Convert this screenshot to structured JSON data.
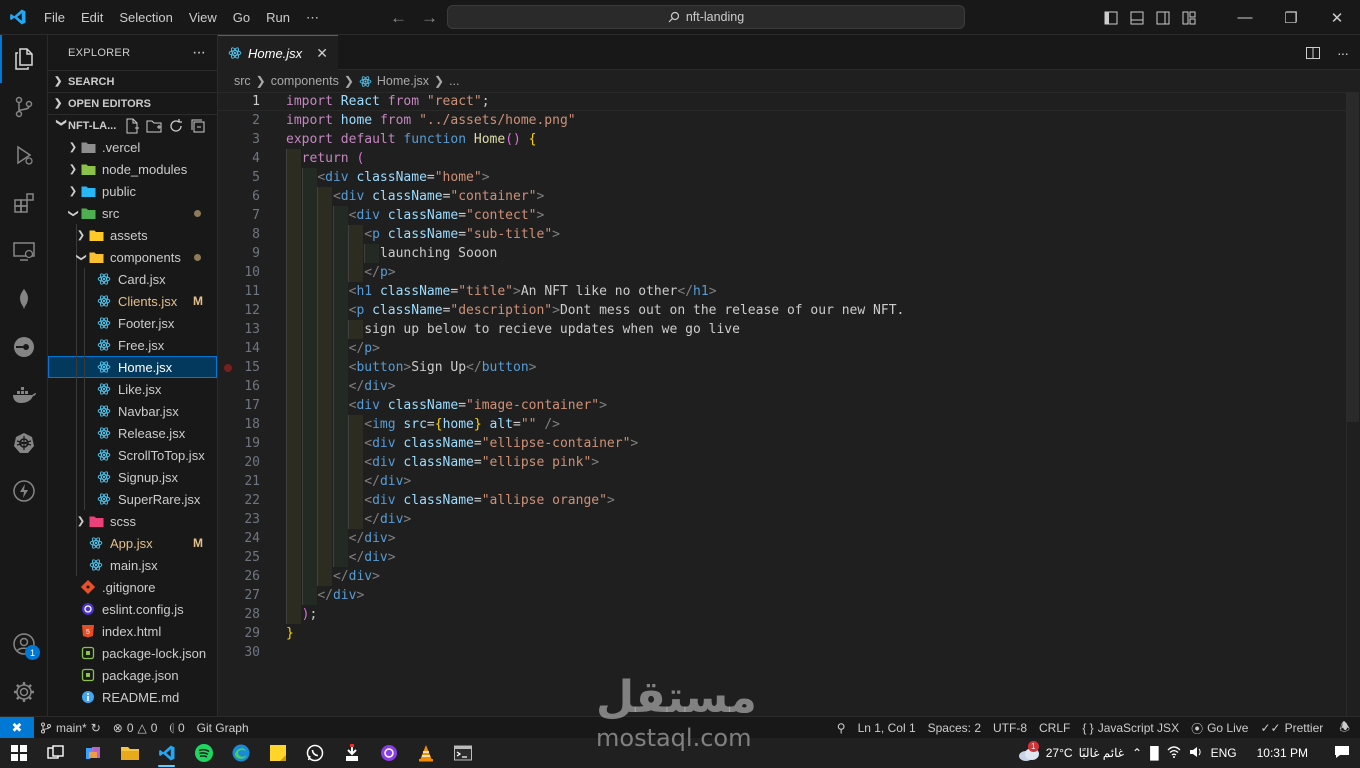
{
  "titlebar": {
    "menu": [
      "File",
      "Edit",
      "Selection",
      "View",
      "Go",
      "Run",
      "⋯"
    ],
    "command_center": "nft-landing"
  },
  "activity_bar": {
    "items": [
      "explorer-icon",
      "source-control-icon",
      "run-debug-icon",
      "extensions-icon",
      "remote-explorer-icon",
      "mongodb-icon",
      "gitlens-icon",
      "docker-icon",
      "kubernetes-icon",
      "thunder-client-icon"
    ],
    "accounts_badge": "1"
  },
  "explorer": {
    "title": "EXPLORER",
    "more": "···",
    "sections": {
      "search": "SEARCH",
      "open_editors": "OPEN EDITORS",
      "project": "NFT-LA..."
    },
    "tree": [
      {
        "label": ".vercel",
        "type": "folder",
        "depth": 1,
        "open": false
      },
      {
        "label": "node_modules",
        "type": "folder",
        "depth": 1,
        "open": false
      },
      {
        "label": "public",
        "type": "folder",
        "depth": 1,
        "open": false
      },
      {
        "label": "src",
        "type": "folder",
        "depth": 1,
        "open": true,
        "status": "dot"
      },
      {
        "label": "assets",
        "type": "folder",
        "depth": 2,
        "open": false
      },
      {
        "label": "components",
        "type": "folder",
        "depth": 2,
        "open": true,
        "status": "dot"
      },
      {
        "label": "Card.jsx",
        "type": "react",
        "depth": 3
      },
      {
        "label": "Clients.jsx",
        "type": "react",
        "depth": 3,
        "status": "M"
      },
      {
        "label": "Footer.jsx",
        "type": "react",
        "depth": 3
      },
      {
        "label": "Free.jsx",
        "type": "react",
        "depth": 3
      },
      {
        "label": "Home.jsx",
        "type": "react",
        "depth": 3,
        "selected": true
      },
      {
        "label": "Like.jsx",
        "type": "react",
        "depth": 3
      },
      {
        "label": "Navbar.jsx",
        "type": "react",
        "depth": 3
      },
      {
        "label": "Release.jsx",
        "type": "react",
        "depth": 3
      },
      {
        "label": "ScrollToTop.jsx",
        "type": "react",
        "depth": 3
      },
      {
        "label": "Signup.jsx",
        "type": "react",
        "depth": 3
      },
      {
        "label": "SuperRare.jsx",
        "type": "react",
        "depth": 3
      },
      {
        "label": "scss",
        "type": "folder",
        "depth": 2,
        "open": false
      },
      {
        "label": "App.jsx",
        "type": "react",
        "depth": 2,
        "status": "M"
      },
      {
        "label": "main.jsx",
        "type": "react",
        "depth": 2
      },
      {
        "label": ".gitignore",
        "type": "git",
        "depth": 1
      },
      {
        "label": "eslint.config.js",
        "type": "js",
        "depth": 1
      },
      {
        "label": "index.html",
        "type": "html",
        "depth": 1
      },
      {
        "label": "package-lock.json",
        "type": "json",
        "depth": 1
      },
      {
        "label": "package.json",
        "type": "json",
        "depth": 1
      },
      {
        "label": "README.md",
        "type": "info",
        "depth": 1
      }
    ]
  },
  "tabs": [
    {
      "label": "Home.jsx",
      "active": true
    }
  ],
  "breadcrumbs": [
    "src",
    "components",
    "Home.jsx",
    "..."
  ],
  "editor": {
    "current_line": 1,
    "breakpoint_line": 15,
    "lines": [
      "import React from \"react\";",
      "import home from \"../assets/home.png\"",
      "export default function Home() {",
      "  return (",
      "    <div className=\"home\">",
      "      <div className=\"container\">",
      "        <div className=\"contect\">",
      "          <p className=\"sub-title\">",
      "            launching Sooon",
      "          </p>",
      "        <h1 className=\"title\">An NFT like no other</h1>",
      "        <p className=\"description\">Dont mess out on the release of our new NFT.",
      "          sign up below to recieve updates when we go live",
      "        </p>",
      "        <button>Sign Up</button>",
      "        </div>",
      "        <div className=\"image-container\">",
      "          <img src={home} alt=\"\" />",
      "          <div className=\"ellipse-container\">",
      "          <div className=\"ellipse pink\">",
      "          </div>",
      "          <div className=\"allipse orange\">",
      "          </div>",
      "        </div>",
      "        </div>",
      "      </div>",
      "    </div>",
      "  );",
      "}",
      ""
    ]
  },
  "status_bar": {
    "branch": "main*",
    "errors": "0",
    "warnings": "0",
    "ports": "0",
    "git_graph": "Git Graph",
    "position": "Ln 1, Col 1",
    "spaces": "Spaces: 2",
    "encoding": "UTF-8",
    "eol": "CRLF",
    "language": "JavaScript JSX",
    "golive": "Go Live",
    "prettier": "Prettier"
  },
  "taskbar": {
    "weather": "27°C",
    "weather_desc": "غائم غالبًا",
    "weather_badge": "1",
    "lang": "ENG",
    "time": "10:31 PM"
  },
  "watermark": {
    "logo_text": "مستقل",
    "site": "mostaql.com"
  },
  "colors": {
    "accent": "#0078d4",
    "modified": "#e2c08d",
    "react": "#4fc1e9"
  }
}
